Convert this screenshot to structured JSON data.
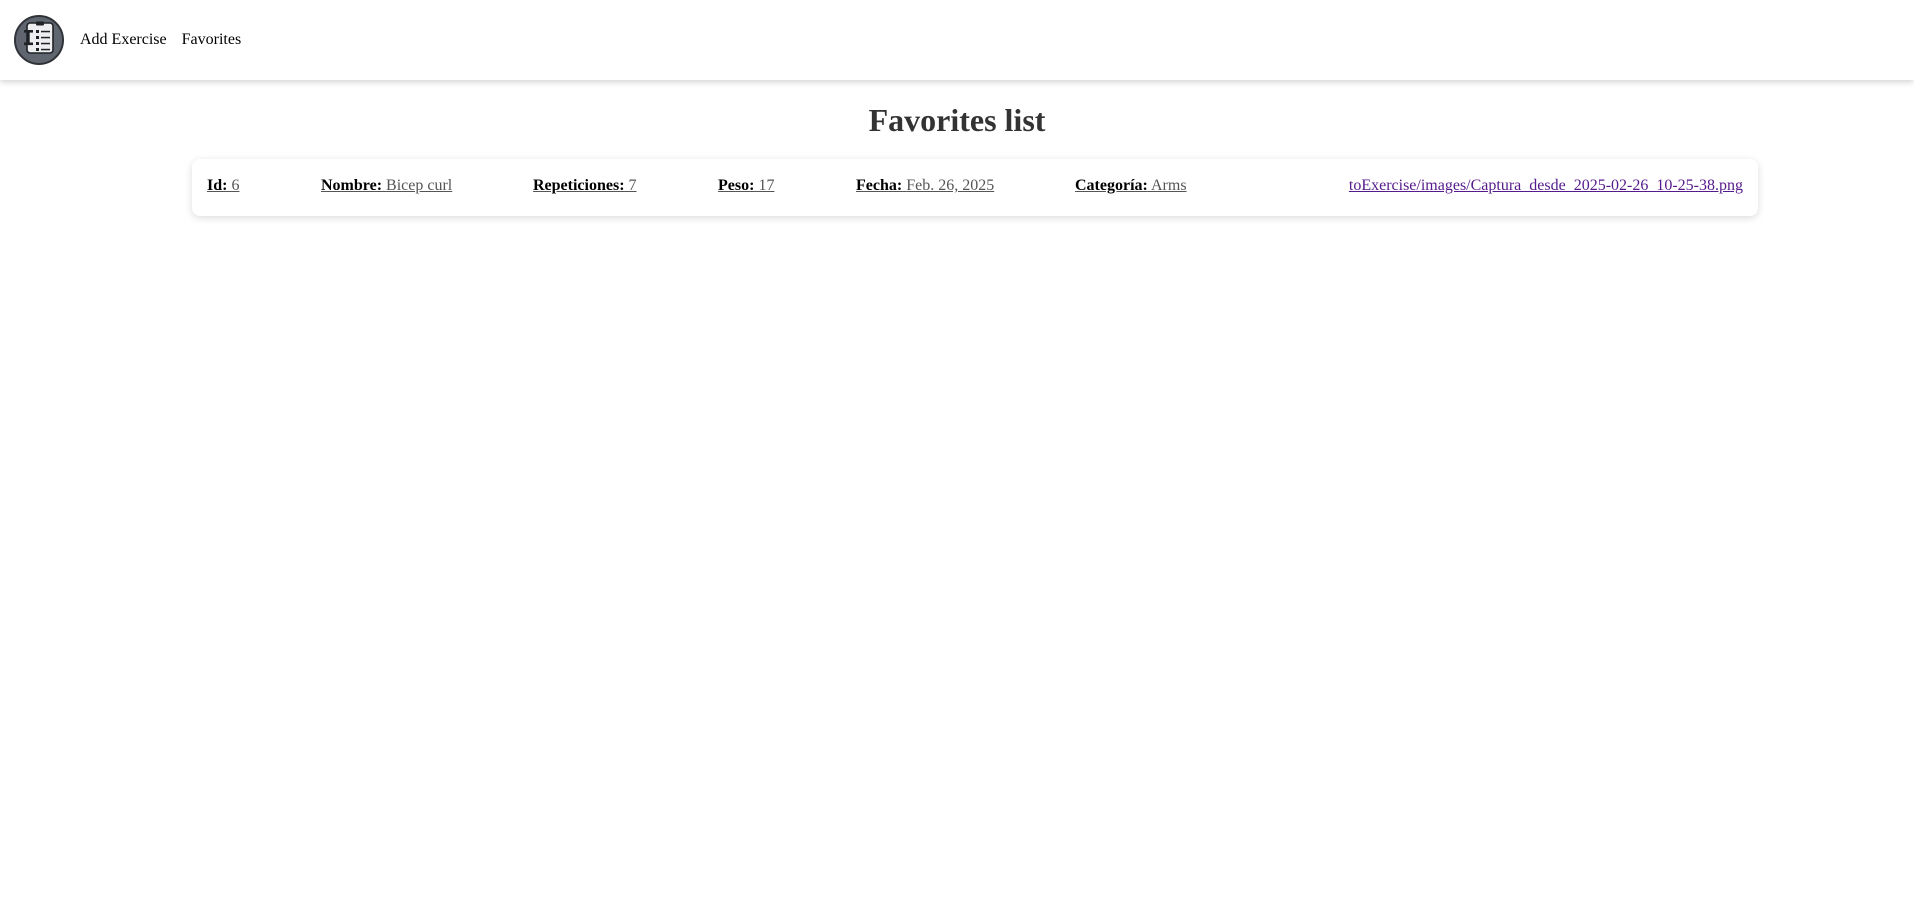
{
  "nav": {
    "logo_icon": "exercise-checklist-icon",
    "links": [
      {
        "label": "Add Exercise"
      },
      {
        "label": "Favorites"
      }
    ]
  },
  "page": {
    "title": "Favorites list"
  },
  "favorites": [
    {
      "id": {
        "label": "Id:",
        "value": "6"
      },
      "nombre": {
        "label": "Nombre:",
        "value": "Bicep curl"
      },
      "repeticiones": {
        "label": "Repeticiones:",
        "value": "7"
      },
      "peso": {
        "label": "Peso:",
        "value": "17"
      },
      "fecha": {
        "label": "Fecha:",
        "value": "Feb. 26, 2025"
      },
      "categoria": {
        "label": "Categoría:",
        "value": "Arms"
      },
      "image": "toExercise/images/Captura_desde_2025-02-26_10-25-38.png"
    }
  ],
  "colors": {
    "title": "#333333",
    "value_text": "#555555",
    "visited_link": "#551a8b",
    "logo_bg": "#5f6670"
  }
}
